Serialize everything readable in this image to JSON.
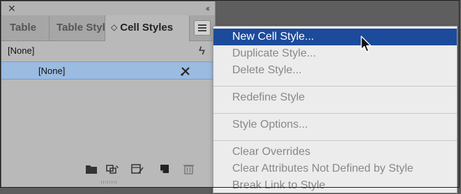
{
  "panel": {
    "tabs": [
      {
        "label": "Table"
      },
      {
        "label": "Table Styl"
      },
      {
        "label": "Cell Styles"
      }
    ],
    "styles": [
      {
        "label": "[None]",
        "icon": "lightning-icon"
      },
      {
        "label": "[None]",
        "icon": "pen-icon"
      }
    ],
    "bottom_icons": [
      "folder-icon",
      "load-styles-icon",
      "clear-overrides-icon",
      "new-style-icon",
      "trash-icon"
    ]
  },
  "menu": {
    "items": [
      {
        "label": "New Cell Style..."
      },
      {
        "label": "Duplicate Style..."
      },
      {
        "label": "Delete Style..."
      },
      {
        "label": "Redefine Style"
      },
      {
        "label": "Style Options..."
      },
      {
        "label": "Clear Overrides"
      },
      {
        "label": "Clear Attributes Not Defined by Style"
      },
      {
        "label": "Break Link to Style"
      }
    ]
  },
  "colors": {
    "panel_bg": "#b9b9b9",
    "selected_row": "#9bbbe0",
    "menu_highlight": "#1c4b9c",
    "menu_bg": "#ececec"
  }
}
